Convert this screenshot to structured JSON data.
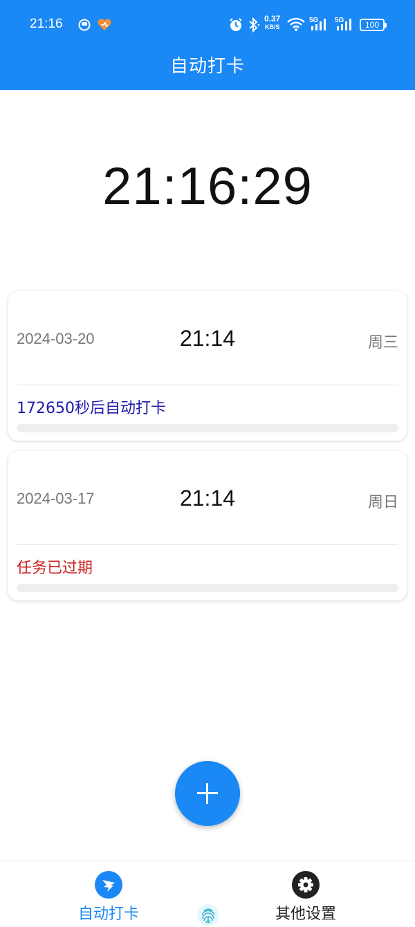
{
  "status_bar": {
    "time": "21:16",
    "net_speed_value": "0.37",
    "net_speed_unit": "KB/S",
    "signal_1": "5G",
    "signal_2": "5G",
    "battery": "100"
  },
  "app_bar": {
    "title": "自动打卡"
  },
  "clock": "21:16:29",
  "tasks": [
    {
      "date": "2024-03-20",
      "time": "21:14",
      "weekday": "周三",
      "status": "172650秒后自动打卡",
      "status_color": "#1c1caa",
      "progress": 0
    },
    {
      "date": "2024-03-17",
      "time": "21:14",
      "weekday": "周日",
      "status": "任务已过期",
      "status_color": "#cc1f1f",
      "progress": 0
    }
  ],
  "fab": {
    "icon": "plus-icon"
  },
  "bottom_nav": {
    "items": [
      {
        "label": "自动打卡",
        "icon": "dingtalk-icon",
        "active": true,
        "color": "#1a88f5"
      },
      {
        "label": "其他设置",
        "icon": "gear-icon",
        "active": false,
        "color": "#222222"
      }
    ],
    "center_icon": "fingerprint-icon"
  },
  "colors": {
    "primary": "#1a88f5",
    "expired": "#cc1f1f",
    "pending": "#1c1caa"
  }
}
